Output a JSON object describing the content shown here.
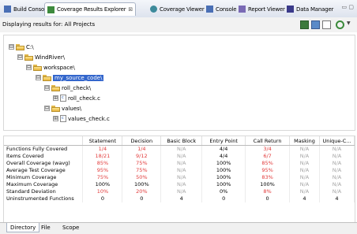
{
  "tabs": [
    {
      "label": "Build Console",
      "icon": "console-icon",
      "color": "#4a6fb5"
    },
    {
      "label": "Coverage Results Explorer",
      "icon": "coverage-results-icon",
      "color": "#3d8a3d",
      "close": "⊠"
    },
    {
      "label": "Coverage Viewer",
      "icon": "coverage-viewer-icon",
      "color": "#3d8a9b"
    },
    {
      "label": "Console",
      "icon": "console-icon",
      "color": "#4a6fb5"
    },
    {
      "label": "Report Viewer",
      "icon": "report-icon",
      "color": "#7a6ab5"
    },
    {
      "label": "Data Manager",
      "icon": "data-manager-icon",
      "color": "#3a3a8a"
    }
  ],
  "window_controls": "▭ ▢",
  "info": {
    "text": "Displaying results for: All Projects"
  },
  "toolbar": {
    "menu_glyph": "▼"
  },
  "tree": [
    {
      "label": "C:\\",
      "depth": 0,
      "exp": "⊟",
      "type": "folder"
    },
    {
      "label": "WindRiver\\",
      "depth": 1,
      "exp": "⊟",
      "type": "folder"
    },
    {
      "label": "workspace\\",
      "depth": 2,
      "exp": "⊟",
      "type": "folder"
    },
    {
      "label": "my_source_code\\",
      "depth": 3,
      "exp": "⊟",
      "type": "folder",
      "selected": true
    },
    {
      "label": "roll_check\\",
      "depth": 4,
      "exp": "⊟",
      "type": "folder"
    },
    {
      "label": "roll_check.c",
      "depth": 5,
      "exp": "⊞",
      "type": "file"
    },
    {
      "label": "values\\",
      "depth": 4,
      "exp": "⊟",
      "type": "folder"
    },
    {
      "label": "values_check.c",
      "depth": 5,
      "exp": "⊞",
      "type": "file"
    }
  ],
  "table": {
    "headers": [
      "",
      "Statement",
      "Decision",
      "Basic Block",
      "Entry Point",
      "Call Return",
      "Masking",
      "Unique-C..."
    ],
    "rows": [
      {
        "label": "Functions Fully Covered",
        "cells": [
          {
            "v": "1/4",
            "c": "red"
          },
          {
            "v": "1/4",
            "c": "red"
          },
          {
            "v": "N/A",
            "c": "gray"
          },
          {
            "v": "4/4",
            "c": "blk"
          },
          {
            "v": "3/4",
            "c": "red"
          },
          {
            "v": "N/A",
            "c": "gray"
          },
          {
            "v": "N/A",
            "c": "gray"
          }
        ]
      },
      {
        "label": "Items Covered",
        "cells": [
          {
            "v": "18/21",
            "c": "red"
          },
          {
            "v": "9/12",
            "c": "red"
          },
          {
            "v": "N/A",
            "c": "gray"
          },
          {
            "v": "4/4",
            "c": "blk"
          },
          {
            "v": "6/7",
            "c": "red"
          },
          {
            "v": "N/A",
            "c": "gray"
          },
          {
            "v": "N/A",
            "c": "gray"
          }
        ]
      },
      {
        "label": "Overall Coverage (wavg)",
        "cells": [
          {
            "v": "85%",
            "c": "red"
          },
          {
            "v": "75%",
            "c": "red"
          },
          {
            "v": "N/A",
            "c": "gray"
          },
          {
            "v": "100%",
            "c": "blk"
          },
          {
            "v": "85%",
            "c": "red"
          },
          {
            "v": "N/A",
            "c": "gray"
          },
          {
            "v": "N/A",
            "c": "gray"
          }
        ]
      },
      {
        "label": "Average Test Coverage",
        "cells": [
          {
            "v": "95%",
            "c": "red"
          },
          {
            "v": "75%",
            "c": "red"
          },
          {
            "v": "N/A",
            "c": "gray"
          },
          {
            "v": "100%",
            "c": "blk"
          },
          {
            "v": "95%",
            "c": "red"
          },
          {
            "v": "N/A",
            "c": "gray"
          },
          {
            "v": "N/A",
            "c": "gray"
          }
        ]
      },
      {
        "label": "Minimum Coverage",
        "cells": [
          {
            "v": "75%",
            "c": "red"
          },
          {
            "v": "50%",
            "c": "red"
          },
          {
            "v": "N/A",
            "c": "gray"
          },
          {
            "v": "100%",
            "c": "blk"
          },
          {
            "v": "83%",
            "c": "red"
          },
          {
            "v": "N/A",
            "c": "gray"
          },
          {
            "v": "N/A",
            "c": "gray"
          }
        ]
      },
      {
        "label": "Maximum Coverage",
        "cells": [
          {
            "v": "100%",
            "c": "blk"
          },
          {
            "v": "100%",
            "c": "blk"
          },
          {
            "v": "N/A",
            "c": "gray"
          },
          {
            "v": "100%",
            "c": "blk"
          },
          {
            "v": "100%",
            "c": "blk"
          },
          {
            "v": "N/A",
            "c": "gray"
          },
          {
            "v": "N/A",
            "c": "gray"
          }
        ]
      },
      {
        "label": "Standard Deviation",
        "cells": [
          {
            "v": "10%",
            "c": "red"
          },
          {
            "v": "20%",
            "c": "red"
          },
          {
            "v": "N/A",
            "c": "gray"
          },
          {
            "v": "0%",
            "c": "blk"
          },
          {
            "v": "8%",
            "c": "red"
          },
          {
            "v": "N/A",
            "c": "gray"
          },
          {
            "v": "N/A",
            "c": "gray"
          }
        ]
      },
      {
        "label": "Uninstrumented Functions",
        "cells": [
          {
            "v": "0",
            "c": "blk"
          },
          {
            "v": "0",
            "c": "blk"
          },
          {
            "v": "4",
            "c": "blk"
          },
          {
            "v": "0",
            "c": "blk"
          },
          {
            "v": "0",
            "c": "blk"
          },
          {
            "v": "4",
            "c": "blk"
          },
          {
            "v": "4",
            "c": "blk"
          }
        ]
      }
    ]
  },
  "bottom_tabs": [
    "Directory",
    "File",
    "Scope"
  ]
}
